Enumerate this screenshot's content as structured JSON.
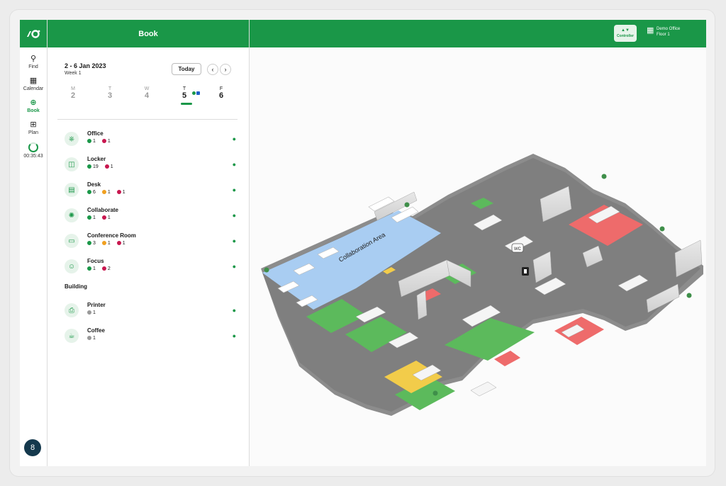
{
  "header": {
    "panel_title": "Book"
  },
  "rail": {
    "items": [
      {
        "label": "Find",
        "icon": "search-icon"
      },
      {
        "label": "Calendar",
        "icon": "calendar-icon"
      },
      {
        "label": "Book",
        "icon": "plus-circle-icon",
        "active": true
      },
      {
        "label": "Plan",
        "icon": "plan-icon"
      }
    ],
    "timer": "00:35:43"
  },
  "week": {
    "range": "2 - 6 Jan 2023",
    "sub": "Week 1",
    "today_label": "Today",
    "days": [
      {
        "letter": "M",
        "num": "2"
      },
      {
        "letter": "T",
        "num": "3"
      },
      {
        "letter": "W",
        "num": "4"
      },
      {
        "letter": "T",
        "num": "5",
        "selected": true
      },
      {
        "letter": "F",
        "num": "6"
      }
    ]
  },
  "categories": [
    {
      "name": "Office",
      "counts": [
        {
          "v": "1",
          "c": "#1a9748"
        },
        {
          "v": "1",
          "c": "#c8174f"
        }
      ]
    },
    {
      "name": "Locker",
      "counts": [
        {
          "v": "19",
          "c": "#1a9748"
        },
        {
          "v": "1",
          "c": "#c8174f"
        }
      ]
    },
    {
      "name": "Desk",
      "counts": [
        {
          "v": "6",
          "c": "#1a9748"
        },
        {
          "v": "1",
          "c": "#f0a020"
        },
        {
          "v": "1",
          "c": "#c8174f"
        }
      ]
    },
    {
      "name": "Collaborate",
      "counts": [
        {
          "v": "1",
          "c": "#1a9748"
        },
        {
          "v": "1",
          "c": "#c8174f"
        }
      ]
    },
    {
      "name": "Conference Room",
      "counts": [
        {
          "v": "3",
          "c": "#1a9748"
        },
        {
          "v": "1",
          "c": "#f0a020"
        },
        {
          "v": "1",
          "c": "#c8174f"
        }
      ]
    },
    {
      "name": "Focus",
      "counts": [
        {
          "v": "1",
          "c": "#1a9748"
        },
        {
          "v": "2",
          "c": "#c8174f"
        }
      ]
    }
  ],
  "building_label": "Building",
  "building": [
    {
      "name": "Printer",
      "counts": [
        {
          "v": "1",
          "c": "#999999"
        }
      ]
    },
    {
      "name": "Coffee",
      "counts": [
        {
          "v": "1",
          "c": "#999999"
        }
      ]
    }
  ],
  "topbar": {
    "controller_label": "Controller",
    "office_name": "Demo Office",
    "floor": "Floor 1"
  },
  "map": {
    "area_label": "Collaboration Area",
    "wc_label": "WC"
  },
  "colors": {
    "brand": "#1a9748",
    "busy": "#c8174f",
    "partial": "#f0a020"
  }
}
